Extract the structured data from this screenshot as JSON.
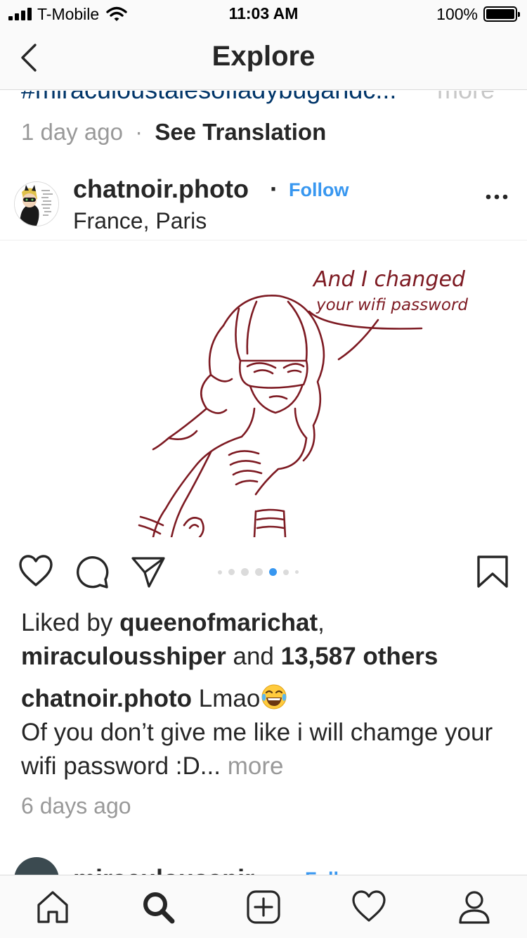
{
  "status_bar": {
    "carrier": "T-Mobile",
    "time": "11:03 AM",
    "battery": "100%",
    "icons": [
      "signal-icon",
      "wifi-icon",
      "battery-icon"
    ]
  },
  "nav": {
    "title": "Explore",
    "back_icon": "chevron-left-icon"
  },
  "previous_post": {
    "hashtag": "#miraculoustalesofladybugandc...",
    "more": "more",
    "time_ago": "1 day ago",
    "separator": "·",
    "see_translation": "See Translation"
  },
  "post": {
    "username": "chatnoir.photo",
    "separator": "·",
    "follow": "Follow",
    "location": "France, Paris",
    "image_text": [
      "And I changed",
      "your wifi password"
    ],
    "carousel": {
      "count": 7,
      "active_index": 4
    },
    "liked_by_prefix": "Liked by ",
    "liker_1": "queenofmarichat",
    "comma": ",",
    "liker_2": "miraculousshiper",
    "and": " and ",
    "others": "13,587 others",
    "caption_user": "chatnoir.photo",
    "caption_text": " Lmao",
    "caption_emoji": "tears-of-joy-emoji",
    "caption_body": "Of you don’t give me like i will chamge your wifi password :D...",
    "caption_more": " more",
    "time_ago": "6 days ago",
    "icons": [
      "heart-icon",
      "comment-icon",
      "share-icon",
      "bookmark-icon",
      "more-icon"
    ]
  },
  "next_post": {
    "username": "miraculousapir",
    "follow": "Follow"
  },
  "tab_bar": {
    "icons": [
      "home-icon",
      "search-icon",
      "add-post-icon",
      "activity-heart-icon",
      "profile-icon"
    ],
    "active": "search-icon"
  },
  "colors": {
    "link_blue": "#3897f0",
    "hashtag_blue": "#003569",
    "text": "#262626",
    "muted": "#999999",
    "drawing": "#7d1a22"
  }
}
